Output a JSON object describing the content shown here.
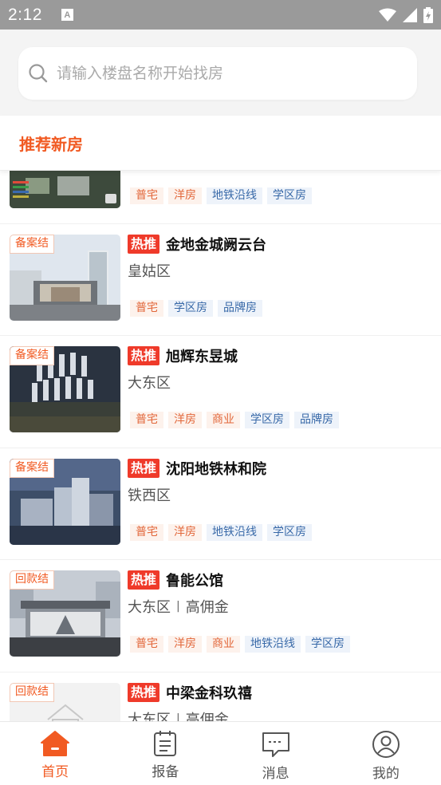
{
  "status_bar": {
    "time": "2:12",
    "notification_letter": "A"
  },
  "search": {
    "placeholder": "请输入楼盘名称开始找房",
    "value": ""
  },
  "section": {
    "title": "推荐新房"
  },
  "listings": [
    {
      "badge": "",
      "hot": "",
      "name": "",
      "district": "",
      "extra": "",
      "tags": [
        {
          "label": "普宅",
          "color": "orange"
        },
        {
          "label": "洋房",
          "color": "orange"
        },
        {
          "label": "地铁沿线",
          "color": "blue"
        },
        {
          "label": "学区房",
          "color": "blue"
        }
      ]
    },
    {
      "badge": "备案结",
      "hot": "热推",
      "name": "金地金城阙云台",
      "district": "皇姑区",
      "extra": "",
      "tags": [
        {
          "label": "普宅",
          "color": "orange"
        },
        {
          "label": "学区房",
          "color": "blue"
        },
        {
          "label": "品牌房",
          "color": "blue"
        }
      ]
    },
    {
      "badge": "备案结",
      "hot": "热推",
      "name": "旭辉东昱城",
      "district": "大东区",
      "extra": "",
      "tags": [
        {
          "label": "普宅",
          "color": "orange"
        },
        {
          "label": "洋房",
          "color": "orange"
        },
        {
          "label": "商业",
          "color": "orange"
        },
        {
          "label": "学区房",
          "color": "blue"
        },
        {
          "label": "品牌房",
          "color": "blue"
        }
      ]
    },
    {
      "badge": "备案结",
      "hot": "热推",
      "name": "沈阳地铁林和院",
      "district": "铁西区",
      "extra": "",
      "tags": [
        {
          "label": "普宅",
          "color": "orange"
        },
        {
          "label": "洋房",
          "color": "orange"
        },
        {
          "label": "地铁沿线",
          "color": "blue"
        },
        {
          "label": "学区房",
          "color": "blue"
        }
      ]
    },
    {
      "badge": "回款结",
      "hot": "热推",
      "name": "鲁能公馆",
      "district": "大东区",
      "extra": "高佣金",
      "tags": [
        {
          "label": "普宅",
          "color": "orange"
        },
        {
          "label": "洋房",
          "color": "orange"
        },
        {
          "label": "商业",
          "color": "orange"
        },
        {
          "label": "地铁沿线",
          "color": "blue"
        },
        {
          "label": "学区房",
          "color": "blue"
        }
      ]
    },
    {
      "badge": "回款结",
      "hot": "热推",
      "name": "中梁金科玖禧",
      "district": "大东区",
      "extra": "高佣金",
      "tags": []
    }
  ],
  "bottom_nav": [
    {
      "label": "首页",
      "icon": "home-icon",
      "active": true
    },
    {
      "label": "报备",
      "icon": "clipboard-icon",
      "active": false
    },
    {
      "label": "消息",
      "icon": "chat-icon",
      "active": false
    },
    {
      "label": "我的",
      "icon": "user-icon",
      "active": false
    }
  ],
  "colors": {
    "accent": "#f15a22",
    "hot": "#ef3a2a",
    "tag_orange": "#e2673a",
    "tag_blue": "#3869a8"
  }
}
